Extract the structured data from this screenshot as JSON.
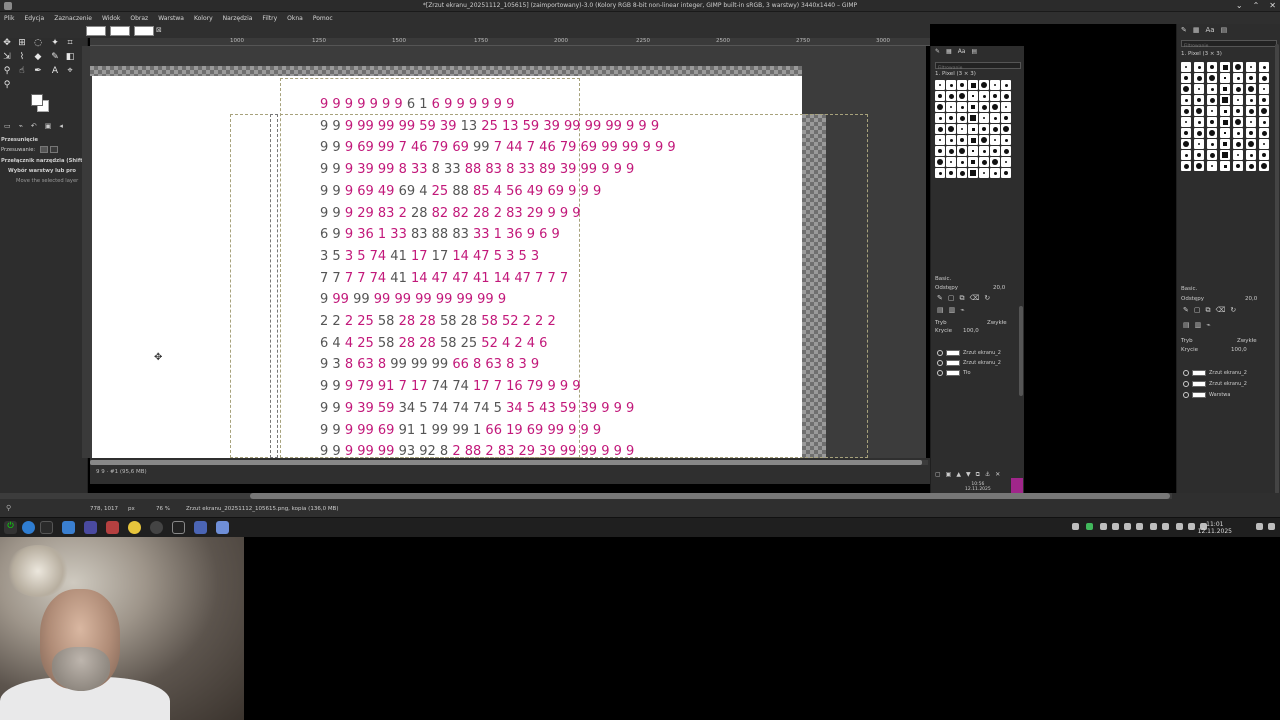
{
  "window": {
    "title": "*[Zrzut ekranu_20251112_105615] (zaimportowany)-3.0 (Kolory RGB 8-bit non-linear integer, GIMP built-in sRGB, 3 warstwy) 3440x1440 – GIMP",
    "minimize": "⌄",
    "maximize": "⌃",
    "close": "✕"
  },
  "menu": [
    "Plik",
    "Edycja",
    "Zaznaczenie",
    "Widok",
    "Obraz",
    "Warstwa",
    "Kolory",
    "Narzędzia",
    "Filtry",
    "Okna",
    "Pomoc"
  ],
  "ruler": {
    "labels": [
      "1000",
      "1250",
      "1500",
      "1750",
      "2000",
      "2250",
      "2500",
      "2750",
      "3000"
    ]
  },
  "tool_options": {
    "header": "Przesunięcie",
    "sub": "Przesuwanie:",
    "toggle": "Przełącznik narzędzia (Shift)",
    "opt1": "Wybór warstwy lub pro",
    "opt2": "Move the selected layer"
  },
  "canvas": {
    "rows": [
      [
        [
          "9 9 9 9 9 9 9 ",
          "pk"
        ],
        [
          "6",
          "gy"
        ],
        [
          " ",
          "pk"
        ],
        [
          "1",
          "gy"
        ],
        [
          " 6 9 9 9 9 9 9",
          "pk"
        ]
      ],
      [
        [
          "9 9 ",
          "gy"
        ],
        [
          "9 99 99 99 ",
          "pk"
        ],
        [
          "59 39 ",
          "pk"
        ],
        [
          "13 ",
          "gy"
        ],
        [
          "25 13 59 39 ",
          "pk"
        ],
        [
          "99 99 99 9 9 9",
          "pk"
        ]
      ],
      [
        [
          "9 9 ",
          "gy"
        ],
        [
          "9 69 99 7 ",
          "pk"
        ],
        [
          "46 79 69 ",
          "pk"
        ],
        [
          "99 ",
          "gy"
        ],
        [
          "7 44 ",
          "pk"
        ],
        [
          "7 46 79 69 99 99 9 9 9",
          "pk"
        ]
      ],
      [
        [
          "9 9 ",
          "gy"
        ],
        [
          "9 39 99 8 33 ",
          "pk"
        ],
        [
          "8 33 ",
          "gy"
        ],
        [
          "88 83 8 33 ",
          "pk"
        ],
        [
          "89 39 99 9 9 9",
          "pk"
        ]
      ],
      [
        [
          "9 9 ",
          "gy"
        ],
        [
          "9 69 49 ",
          "pk"
        ],
        [
          "69 4 ",
          "gy"
        ],
        [
          "25 ",
          "pk"
        ],
        [
          "88 ",
          "gy"
        ],
        [
          "85 4 56 49 69 9 9 9",
          "pk"
        ]
      ],
      [
        [
          "9 9 ",
          "gy"
        ],
        [
          "9 29 83 2 ",
          "pk"
        ],
        [
          "28 ",
          "gy"
        ],
        [
          "82 82 28 ",
          "pk"
        ],
        [
          "2 83 29 9 9 9",
          "pk"
        ]
      ],
      [
        [
          "6 9 ",
          "gy"
        ],
        [
          "9 36 1 33 ",
          "pk"
        ],
        [
          "83 88 83 ",
          "gy"
        ],
        [
          "33 1 36 9 6 9",
          "pk"
        ]
      ],
      [
        [
          "3 5 ",
          "gy"
        ],
        [
          "3 5 74 ",
          "pk"
        ],
        [
          "41 ",
          "gy"
        ],
        [
          "17 ",
          "pk"
        ],
        [
          "17 ",
          "gy"
        ],
        [
          "14 47 5 3 5 3",
          "pk"
        ]
      ],
      [
        [
          "7 7 ",
          "gy"
        ],
        [
          "7 7 74 ",
          "pk"
        ],
        [
          "41 ",
          "gy"
        ],
        [
          "14 47 47 41 ",
          "pk"
        ],
        [
          "14 47 7 7 7",
          "pk"
        ]
      ],
      [
        [
          "9 ",
          "gy"
        ],
        [
          "99 ",
          "pk"
        ],
        [
          "99 ",
          "gy"
        ],
        [
          "99 99 99 ",
          "pk"
        ],
        [
          "99 99 99 9",
          "pk"
        ]
      ],
      [
        [
          "2 2 ",
          "gy"
        ],
        [
          "2 25 ",
          "pk"
        ],
        [
          "58 ",
          "gy"
        ],
        [
          "28 28 ",
          "pk"
        ],
        [
          "58 28 ",
          "gy"
        ],
        [
          "58 52 2 2 2",
          "pk"
        ]
      ],
      [
        [
          "6 4 ",
          "gy"
        ],
        [
          "4 25 ",
          "pk"
        ],
        [
          "58 ",
          "gy"
        ],
        [
          "28 28 ",
          "pk"
        ],
        [
          "58 25 ",
          "gy"
        ],
        [
          "52 4 2 4 6",
          "pk"
        ]
      ],
      [
        [
          "9 3 ",
          "gy"
        ],
        [
          "8 63 8 ",
          "pk"
        ],
        [
          "99 99 99 ",
          "gy"
        ],
        [
          "66 8 63 8 3 9",
          "pk"
        ]
      ],
      [
        [
          "9 9 ",
          "gy"
        ],
        [
          "9 79 91 7 17 ",
          "pk"
        ],
        [
          "74 74 ",
          "gy"
        ],
        [
          "17 7 16 79 9 9 9",
          "pk"
        ]
      ],
      [
        [
          "9 9 ",
          "gy"
        ],
        [
          "9 39 59 ",
          "pk"
        ],
        [
          "34 5 74 74 74 5 ",
          "gy"
        ],
        [
          "34 5 43 59 39 9 9 9",
          "pk"
        ]
      ],
      [
        [
          "9 9 ",
          "gy"
        ],
        [
          "9 99 69 ",
          "pk"
        ],
        [
          "91 1 99 99 1 ",
          "gy"
        ],
        [
          "66 19 69 99 9 9 9",
          "pk"
        ]
      ],
      [
        [
          "9 9 ",
          "gy"
        ],
        [
          "9 99 99 ",
          "pk"
        ],
        [
          "93 92 8 ",
          "gy"
        ],
        [
          "2 88 2 83 29 39 99 99 9 9 9",
          "pk"
        ]
      ]
    ]
  },
  "canvas_status": {
    "info": "9  9  · #1 (95,6 MB)"
  },
  "status": {
    "coords": "778, 1017",
    "unit": "px",
    "zoom": "76 %",
    "file": "Zrzut ekranu_20251112_105615.png, kopia (136,0 MB)"
  },
  "dock1": {
    "filter_placeholder": "Filtrowanie",
    "brush_name": "1. Pixel (3 × 3)",
    "preset": "Basic.",
    "spacing_label": "Odstępy",
    "spacing_value": "20,0",
    "mode_label": "Tryb",
    "mode_value": "Zwykłe",
    "opacity_label": "Krycie",
    "opacity_value": "100,0",
    "layers": [
      "Zrzut ekranu_2",
      "Zrzut ekranu_2",
      "Tło"
    ],
    "mini_clock_time": "10:56",
    "mini_clock_date": "12.11.2025"
  },
  "dock2": {
    "filter_placeholder": "Filtrowanie",
    "brush_name": "1. Pixel (3 × 3)",
    "preset": "Basic.",
    "spacing_label": "Odstępy",
    "spacing_value": "20,0",
    "mode_label": "Tryb",
    "mode_value": "Zwykłe",
    "opacity_label": "Krycie",
    "opacity_value": "100,0",
    "layers": [
      "Zrzut ekranu_2",
      "Zrzut ekranu_2",
      "Warstwa"
    ]
  },
  "taskbar": {
    "time": "11:01",
    "date": "12.11.2025"
  },
  "colors": {
    "pink": "#c2187a",
    "gray": "#555555",
    "panel": "#2d2d2d",
    "canvas_bg": "#3c3c3c"
  }
}
